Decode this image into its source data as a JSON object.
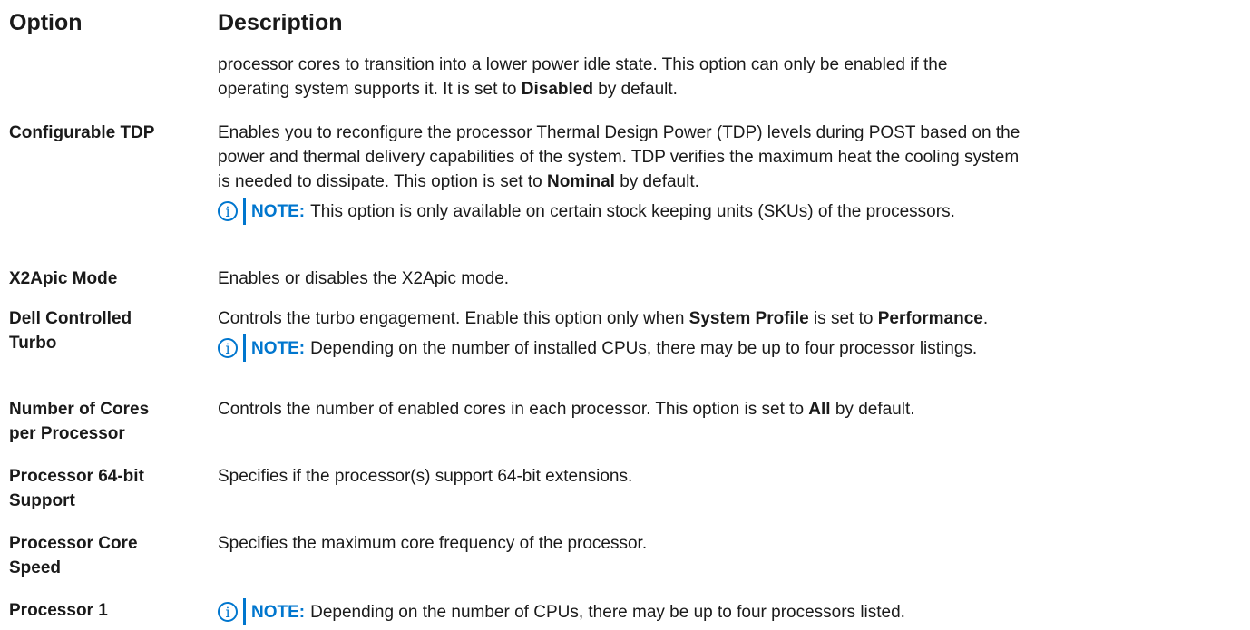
{
  "header": {
    "option": "Option",
    "description": "Description"
  },
  "rows": {
    "cont": {
      "line1": "processor cores to transition into a lower power idle state. This option can only be enabled if the",
      "line2_pre": "operating system supports it. It is set to ",
      "line2_bold": "Disabled",
      "line2_post": " by default."
    },
    "tdp": {
      "option": "Configurable TDP",
      "line1": "Enables you to reconfigure the processor Thermal Design Power (TDP) levels during POST based on the",
      "line2": "power and thermal delivery capabilities of the system. TDP verifies the maximum heat the cooling system",
      "line3_pre": "is needed to dissipate. This option is set to ",
      "line3_bold": "Nominal",
      "line3_post": " by default.",
      "note_label": "NOTE:",
      "note_text": "This option is only available on certain stock keeping units (SKUs) of the processors."
    },
    "x2apic": {
      "option": "X2Apic Mode",
      "desc": "Enables or disables the X2Apic mode."
    },
    "turbo": {
      "option_line1": "Dell Controlled",
      "option_line2": "Turbo",
      "desc_pre": "Controls the turbo engagement. Enable this option only when ",
      "desc_bold1": "System Profile",
      "desc_mid": " is set to ",
      "desc_bold2": "Performance",
      "desc_post": ".",
      "note_label": "NOTE:",
      "note_text": "Depending on the number of installed CPUs, there may be up to four processor listings."
    },
    "cores": {
      "option_line1": "Number of Cores",
      "option_line2": "per Processor",
      "desc_pre": "Controls the number of enabled cores in each processor. This option is set to ",
      "desc_bold": "All",
      "desc_post": " by default."
    },
    "bit64": {
      "option_line1": "Processor 64-bit",
      "option_line2": "Support",
      "desc": "Specifies if the processor(s) support 64-bit extensions."
    },
    "speed": {
      "option_line1": "Processor Core",
      "option_line2": "Speed",
      "desc": "Specifies the maximum core frequency of the processor."
    },
    "proc1": {
      "option": "Processor 1",
      "note_label": "NOTE:",
      "note_text": "Depending on the number of CPUs, there may be up to four processors listed."
    }
  },
  "icons": {
    "info": "info-icon",
    "info_glyph": "i"
  },
  "colors": {
    "note_accent": "#0076ce",
    "text": "#1a1a1a"
  }
}
